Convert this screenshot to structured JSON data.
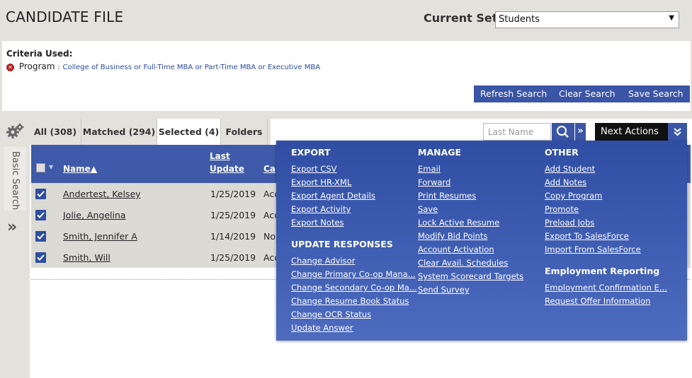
{
  "header": {
    "title": "CANDIDATE FILE",
    "current_set_label": "Current Set:",
    "current_set_value": "Students"
  },
  "criteria": {
    "label": "Criteria Used:",
    "program_label": "Program",
    "program_sep": ":",
    "program_value": "College of Business or Full-Time MBA or Part-Time MBA or Executive MBA",
    "buttons": [
      "Refresh Search",
      "Clear Search",
      "Save Search"
    ]
  },
  "rail": {
    "basic_search": "Basic Search",
    "expand": "»"
  },
  "tabs": [
    {
      "label": "All (308)"
    },
    {
      "label": "Matched (294)"
    },
    {
      "label": "Selected (4)"
    },
    {
      "label": "Folders"
    }
  ],
  "toolbar": {
    "search_placeholder": "Last Name",
    "expand": "»",
    "next_actions": "Next Actions",
    "toggle": "»"
  },
  "table": {
    "headers": {
      "name": "Name▲",
      "last_update_1": "Last",
      "last_update_2": "Update",
      "third": "Ca"
    },
    "rows": [
      {
        "name": "Andertest, Kelsey",
        "date": "1/25/2019",
        "col3": "Acc"
      },
      {
        "name": "Jolie, Angelina",
        "date": "1/25/2019",
        "col3": "Acc"
      },
      {
        "name": "Smith, Jennifer A",
        "date": "1/14/2019",
        "col3": "No"
      },
      {
        "name": "Smith, Will",
        "date": "1/25/2019",
        "col3": "Acc"
      }
    ]
  },
  "menu": {
    "export": {
      "title": "EXPORT",
      "items": [
        "Export CSV",
        "Export HR-XML",
        "Export Agent Details",
        "Export Activity",
        "Export Notes"
      ]
    },
    "update_responses": {
      "title": "UPDATE RESPONSES",
      "items": [
        "Change Advisor",
        "Change Primary Co-op Mana...",
        "Change Secondary Co-op Ma...",
        "Change Resume Book Status",
        "Change OCR Status",
        "Update Answer"
      ]
    },
    "manage": {
      "title": "MANAGE",
      "items": [
        "Email",
        "Forward",
        "Print Resumes",
        "Save",
        "Lock Active Resume",
        "Modify Bid Points",
        "Account Activation",
        "Clear Avail. Schedules",
        "System Scorecard Targets",
        "Send Survey"
      ]
    },
    "other": {
      "title": "OTHER",
      "items": [
        "Add Student",
        "Add Notes",
        "Copy Program",
        "Promote",
        "Preload Jobs",
        "Export To SalesForce",
        "Import From SalesForce"
      ]
    },
    "employment": {
      "title": "Employment Reporting",
      "items": [
        "Employment Confirmation E...",
        "Request Offer Information"
      ]
    }
  },
  "colors": {
    "accent": "#3a55a6",
    "menu": "#3552a6",
    "background": "#e3e1dc"
  }
}
